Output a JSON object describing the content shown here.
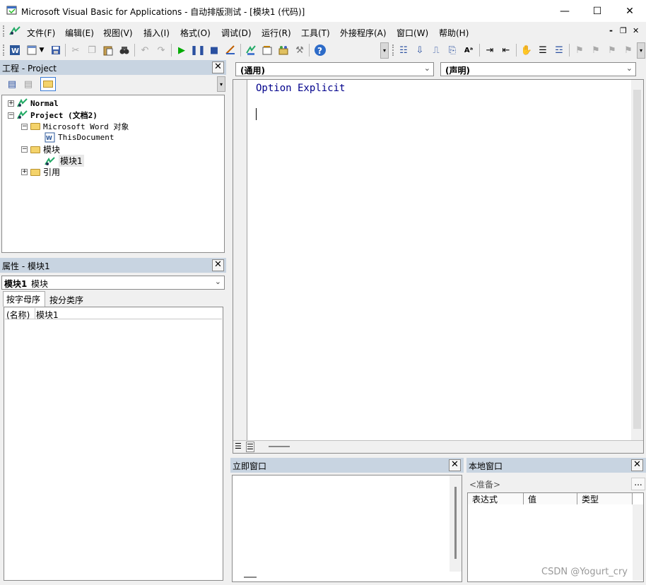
{
  "window": {
    "title": "Microsoft Visual Basic for Applications - 自动排版测试 - [模块1 (代码)]",
    "minimize": "—",
    "maximize": "☐",
    "close": "✕"
  },
  "menu": [
    {
      "label": "文件(F)"
    },
    {
      "label": "编辑(E)"
    },
    {
      "label": "视图(V)"
    },
    {
      "label": "插入(I)"
    },
    {
      "label": "格式(O)"
    },
    {
      "label": "调试(D)"
    },
    {
      "label": "运行(R)"
    },
    {
      "label": "工具(T)"
    },
    {
      "label": "外接程序(A)"
    },
    {
      "label": "窗口(W)"
    },
    {
      "label": "帮助(H)"
    }
  ],
  "menu_right": {
    "min": "-",
    "restore": "❐",
    "close": "✕"
  },
  "project": {
    "title": "工程 - Project",
    "tree": [
      {
        "label": "Normal",
        "bold": true,
        "expander": "+"
      },
      {
        "label": "Project (文档2)",
        "bold": true,
        "expander": "−"
      },
      {
        "label": "Microsoft Word 对象",
        "expander": "−"
      },
      {
        "label": "ThisDocument"
      },
      {
        "label": "模块",
        "expander": "−"
      },
      {
        "label": "模块1"
      },
      {
        "label": "引用",
        "expander": "+"
      }
    ]
  },
  "properties": {
    "title": "属性 - 模块1",
    "object_name": "模块1",
    "object_type": "模块",
    "tabs": [
      "按字母序",
      "按分类序"
    ],
    "row_name": "(名称)",
    "row_value": "模块1"
  },
  "code": {
    "object_combo": "(通用)",
    "proc_combo": "(声明)",
    "line1": "Option Explicit"
  },
  "immediate": {
    "title": "立即窗口"
  },
  "locals": {
    "title": "本地窗口",
    "status": "<准备>",
    "ellipsis": "...",
    "columns": [
      "表达式",
      "值",
      "类型"
    ]
  },
  "watermark": "CSDN @Yogurt_cry",
  "icons": {
    "colors": {
      "accent": "#0000ff",
      "run": "#008000",
      "panel_header": "#c8d4e1"
    }
  }
}
